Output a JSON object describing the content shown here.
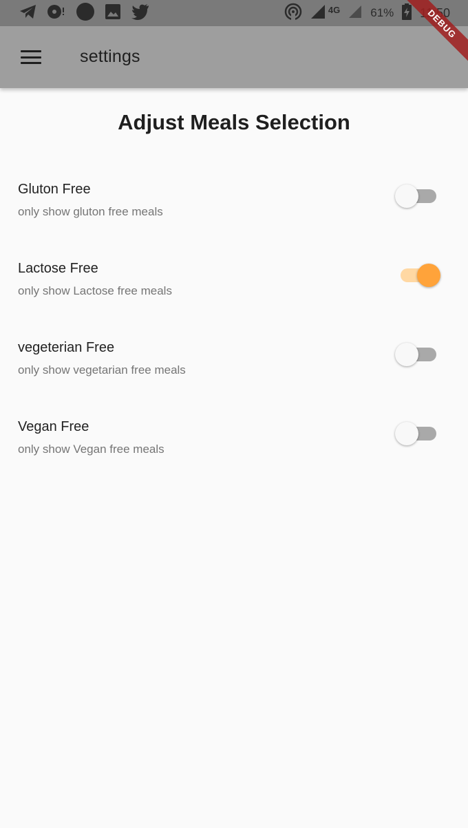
{
  "status_bar": {
    "signal_label": "4G",
    "battery": "61%",
    "time": "11:50"
  },
  "debug_label": "DEBUG",
  "app_bar": {
    "title": "settings"
  },
  "heading": "Adjust Meals Selection",
  "settings": [
    {
      "title": "Gluton Free",
      "subtitle": "only show gluton free meals",
      "enabled": false
    },
    {
      "title": "Lactose Free",
      "subtitle": "only show Lactose free meals",
      "enabled": true
    },
    {
      "title": "vegeterian Free",
      "subtitle": "only show vegetarian free meals",
      "enabled": false
    },
    {
      "title": "Vegan Free",
      "subtitle": "only show Vegan free meals",
      "enabled": false
    }
  ],
  "colors": {
    "accent": "#ffa33a",
    "accent_track": "#ffd8a3",
    "app_bar": "#9e9e9e",
    "status_bar": "#7a7a7a"
  }
}
